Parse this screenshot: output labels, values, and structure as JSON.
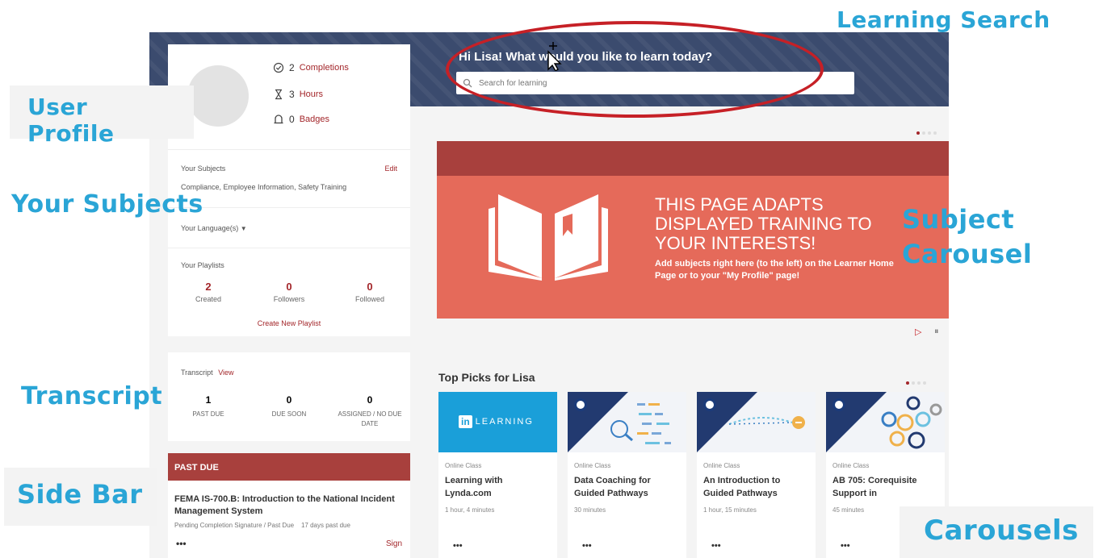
{
  "callouts": {
    "learning_search": "Learning Search",
    "user_profile": "User Profile",
    "your_subjects": "Your Subjects",
    "subject_carousel_line1": "Subject",
    "subject_carousel_line2": "Carousel",
    "transcript": "Transcript",
    "side_bar": "Side Bar",
    "carousels": "Carousels"
  },
  "search": {
    "greeting": "Hi Lisa! What would you like to learn today?",
    "placeholder": "Search for learning"
  },
  "profile": {
    "completions_count": "2",
    "completions_label": "Completions",
    "hours_count": "3",
    "hours_label": "Hours",
    "badges_count": "0",
    "badges_label": "Badges"
  },
  "subjects": {
    "heading": "Your Subjects",
    "edit_label": "Edit",
    "list": "Compliance, Employee Information, Safety Training",
    "language_label": "Your Language(s)"
  },
  "playlists": {
    "heading": "Your Playlists",
    "created_count": "2",
    "created_label": "Created",
    "followers_count": "0",
    "followers_label": "Followers",
    "followed_count": "0",
    "followed_label": "Followed",
    "create_label": "Create New Playlist"
  },
  "transcript": {
    "heading": "Transcript",
    "view_label": "View",
    "past_due_count": "1",
    "past_due_label": "PAST DUE",
    "due_soon_count": "0",
    "due_soon_label": "DUE SOON",
    "assigned_count": "0",
    "assigned_label_line1": "ASSIGNED / NO DUE",
    "assigned_label_line2": "DATE"
  },
  "past_due": {
    "header": "PAST DUE",
    "title": "FEMA IS-700.B: Introduction to the National Incident Management System",
    "status": "Pending Completion Signature / Past Due",
    "days": "17 days past due",
    "more": "•••",
    "sign_label": "Sign"
  },
  "hero": {
    "headline_line1": "THIS PAGE ADAPTS",
    "headline_line2": "DISPLAYED TRAINING TO",
    "headline_line3": "YOUR INTERESTS!",
    "body": "Add subjects right here (to the left) on the Learner Home Page or to your \"My Profile\" page!",
    "play_glyph": "▷",
    "pause_glyph": "⏸"
  },
  "top_picks": {
    "title": "Top Picks for Lisa",
    "tiles": [
      {
        "type": "Online Class",
        "name": "Learning with Lynda.com",
        "duration": "1 hour, 4 minutes",
        "more": "•••",
        "logo_text": "LEARNING",
        "logo_mark": "in"
      },
      {
        "type": "Online Class",
        "name": "Data Coaching for Guided Pathways",
        "duration": "30 minutes",
        "more": "•••"
      },
      {
        "type": "Online Class",
        "name": "An Introduction to Guided Pathways",
        "duration": "1 hour, 15 minutes",
        "more": "•••"
      },
      {
        "type": "Online Class",
        "name": "AB 705: Corequisite Support in",
        "duration": "45 minutes",
        "more": "•••"
      }
    ]
  },
  "colors": {
    "accent": "#a3262a",
    "callout": "#2aa5d6",
    "banner": "#3b4b6e",
    "hero": "#e56a5a",
    "linkedin": "#1a9fd9"
  }
}
